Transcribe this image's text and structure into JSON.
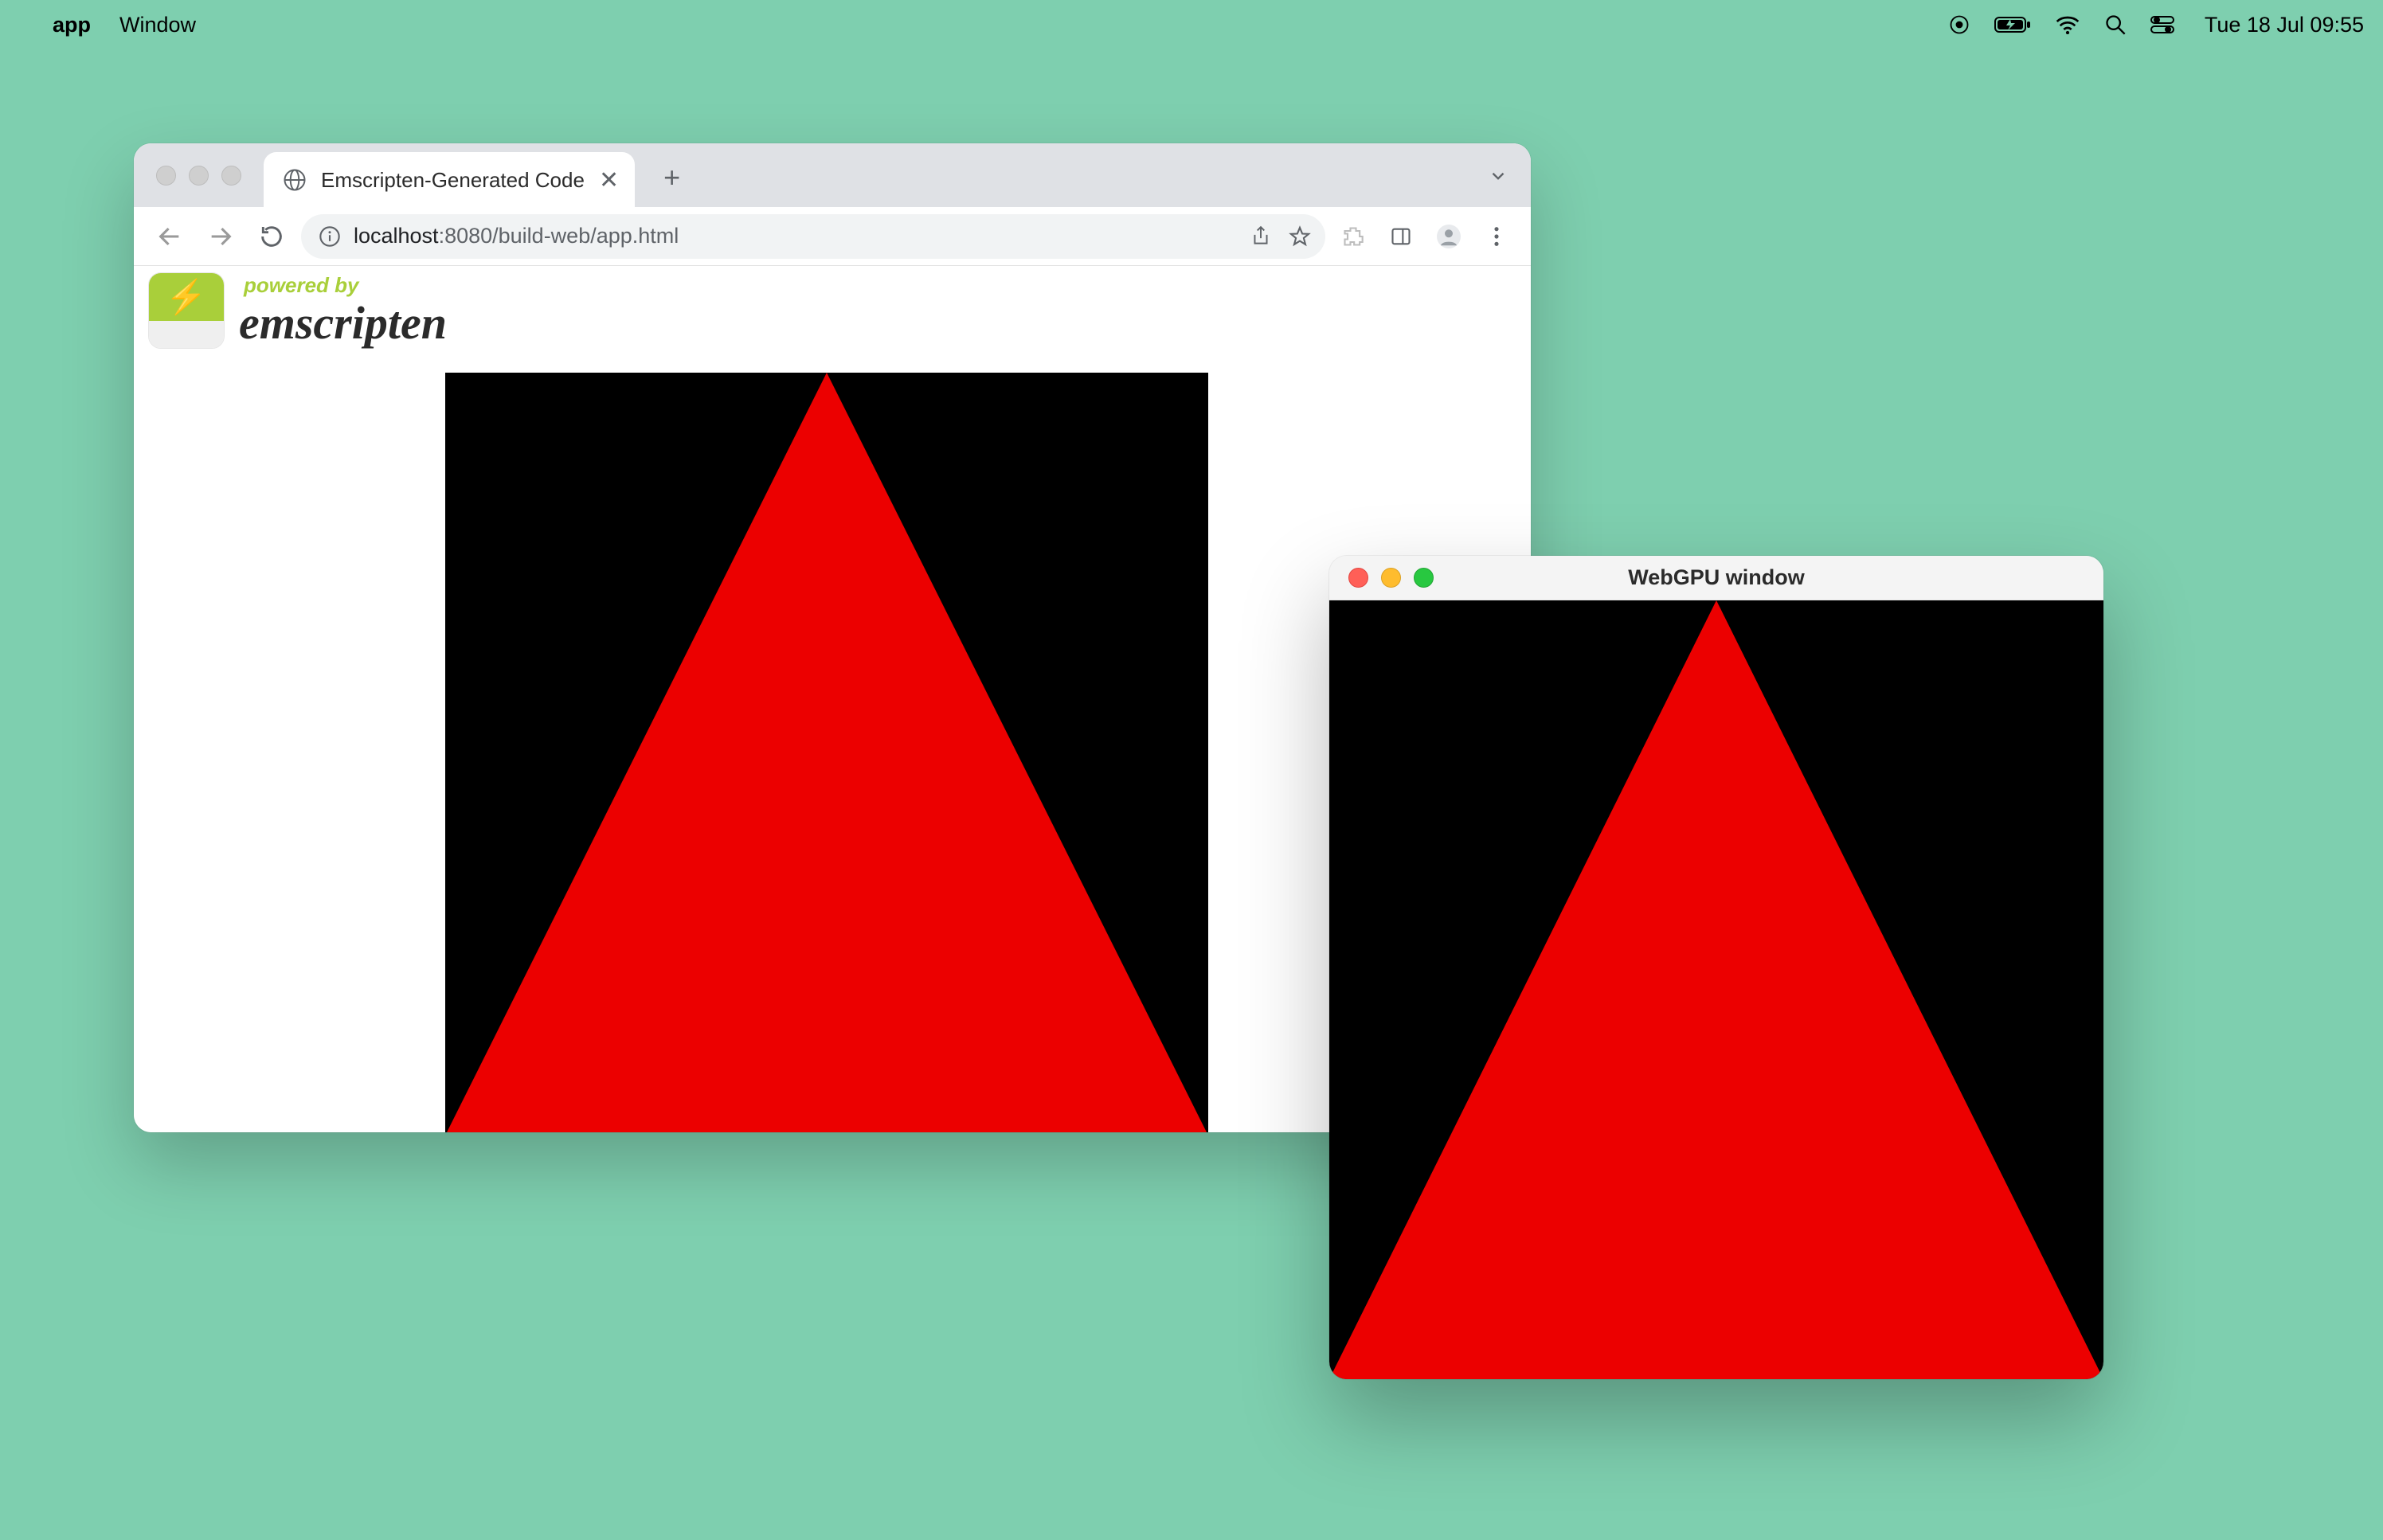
{
  "menubar": {
    "app_name": "app",
    "window_menu": "Window",
    "datetime": "Tue 18 Jul  09:55"
  },
  "browser": {
    "tab_title": "Emscripten-Generated Code",
    "url_host": "localhost",
    "url_rest": ":8080/build-web/app.html",
    "emscripten_powered": "powered by",
    "emscripten_name": "emscripten"
  },
  "appwin": {
    "title": "WebGPU window"
  },
  "colors": {
    "desktop": "#7ecfaf",
    "triangle": "#ec0000",
    "canvas_bg": "#000000"
  }
}
